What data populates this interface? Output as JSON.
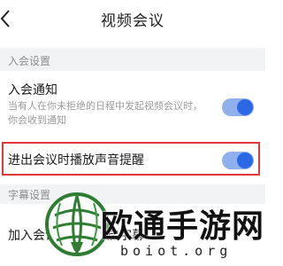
{
  "nav": {
    "title": "视频会议",
    "back_icon": "chevron-left-icon"
  },
  "sections": [
    {
      "header": "入会设置",
      "items": [
        {
          "title": "入会通知",
          "description": "当有人在你未拒绝的日程中发起视频会议时，你会收到通知",
          "toggle_on": true
        },
        {
          "title": "进出会议时播放声音提醒",
          "toggle_on": true,
          "highlighted": true
        }
      ]
    },
    {
      "header": "字幕设置",
      "items": [
        {
          "title": "加入会议时自动开启字幕"
        }
      ]
    }
  ],
  "colors": {
    "toggle_track": "#8fb0ec",
    "toggle_knob": "#2c68e6",
    "highlight_border": "#e0393a",
    "section_bg": "#f2f3f5"
  },
  "watermark": {
    "text": "欧通手游网",
    "url": "boiot.org"
  }
}
